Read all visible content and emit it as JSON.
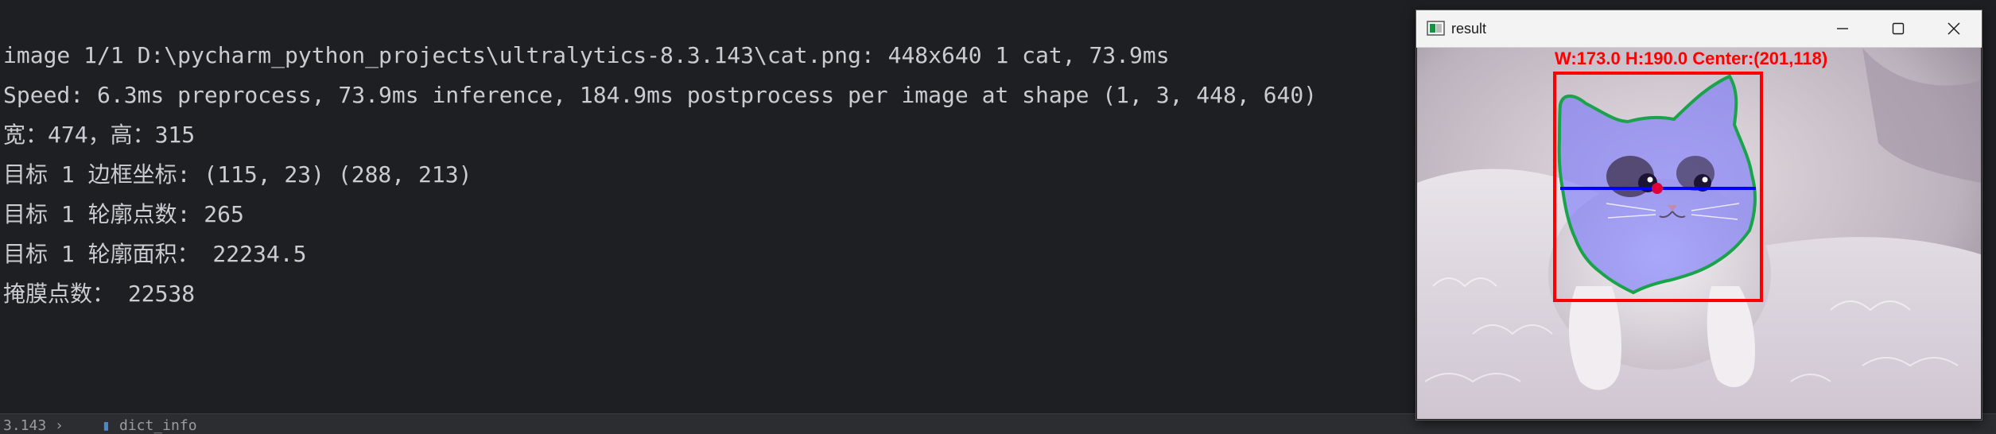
{
  "console": {
    "lines": [
      "image 1/1 D:\\pycharm_python_projects\\ultralytics-8.3.143\\cat.png: 448x640 1 cat, 73.9ms",
      "Speed: 6.3ms preprocess, 73.9ms inference, 184.9ms postprocess per image at shape (1, 3, 448, 640)",
      "宽：474，高：315",
      "目标 1 边框坐标: (115, 23) (288, 213)",
      "目标 1 轮廓点数: 265",
      "目标 1 轮廓面积： 22234.5",
      "掩膜点数： 22538"
    ]
  },
  "statusbar": {
    "left_text": "3.143 ›",
    "right_text": "dict_info"
  },
  "window": {
    "title": "result",
    "image_overlay_text": "W:173.0  H:190.0  Center:(201,118)",
    "icons": [
      "app-icon",
      "minimize-icon",
      "maximize-icon",
      "close-icon"
    ]
  },
  "colors": {
    "console_bg": "#1e1f22",
    "console_text": "#c9ccd2",
    "bbox": "#ff0000",
    "contour": "#1aa34a",
    "mask": "#6b6bff",
    "center_line": "#0000ff",
    "center_point": "#e0003a"
  }
}
